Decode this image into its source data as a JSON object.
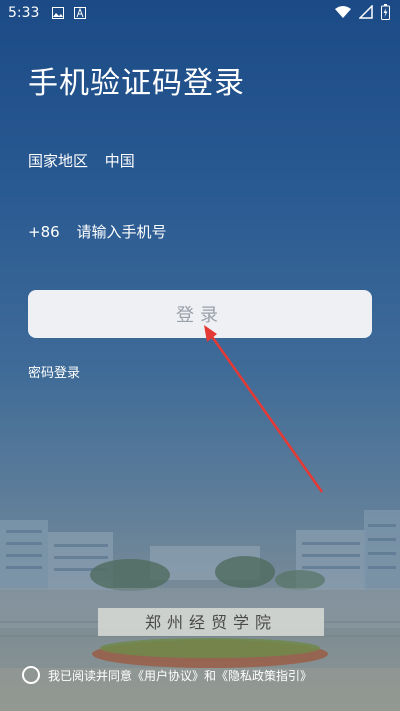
{
  "status_bar": {
    "time": "5:33",
    "icons": [
      "image-icon",
      "a-notify-icon",
      "wifi-icon",
      "signal-icon",
      "battery-icon"
    ]
  },
  "title": "手机验证码登录",
  "country": {
    "label": "国家地区",
    "value": "中国"
  },
  "phone": {
    "prefix": "+86",
    "placeholder": "请输入手机号",
    "value": ""
  },
  "login_button": {
    "label": "登录"
  },
  "password_login": {
    "label": "密码登录"
  },
  "agreement": {
    "text_prefix": "我已阅读并同意",
    "user_agreement": "《用户协议》",
    "and": "和",
    "privacy_policy": "《隐私政策指引》"
  },
  "background": {
    "gate_text": "郑州经贸学院"
  },
  "colors": {
    "accent_red": "#e53935",
    "bg_top": "#1b4a86",
    "button_bg": "#eef0f4",
    "button_text": "#9aa0a8"
  }
}
